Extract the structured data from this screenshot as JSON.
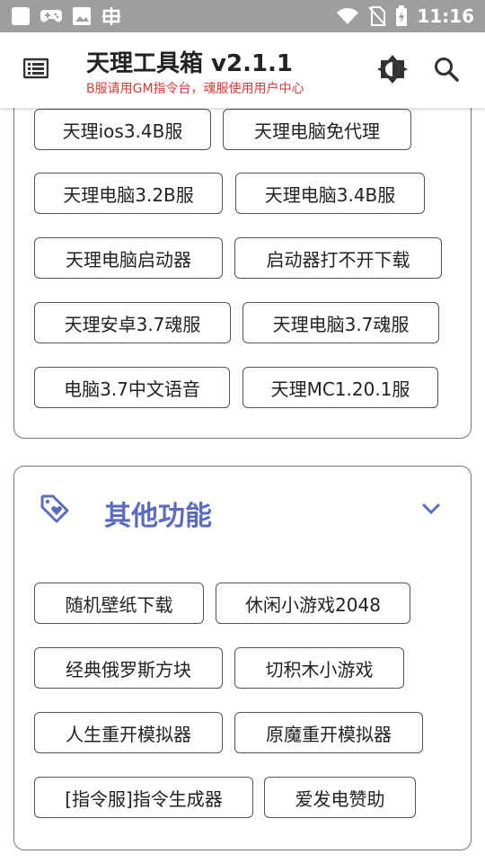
{
  "status_bar": {
    "time": "11:16",
    "icons": [
      "app-square-icon",
      "gamepad-icon",
      "image-icon",
      "bug-icon",
      "wifi-icon",
      "no-sim-icon",
      "battery-charging-icon"
    ]
  },
  "appbar": {
    "title": "天理工具箱 v2.1.1",
    "subtitle": "B服请用GM指令台，魂服使用用户中心",
    "icons": [
      "menu-icon",
      "brightness-icon",
      "search-icon"
    ]
  },
  "section_top": {
    "buttons": [
      "天理ios3.4B服",
      "天理电脑免代理",
      "天理电脑3.2B服",
      "天理电脑3.4B服",
      "天理电脑启动器",
      "启动器打不开下载",
      "天理安卓3.7魂服",
      "天理电脑3.7魂服",
      "电脑3.7中文语音",
      "天理MC1.20.1服"
    ]
  },
  "section_other": {
    "title": "其他功能",
    "icon": "tag-heart-icon",
    "toggle_icon": "chevron-down-icon",
    "buttons": [
      "随机壁纸下载",
      "休闲小游戏2048",
      "经典俄罗斯方块",
      "切积木小游戏",
      "人生重开模拟器",
      "原魔重开模拟器",
      "[指令服]指令生成器",
      "爱发电赞助"
    ]
  },
  "colors": {
    "status_bar": "#9e9e9e",
    "accent": "#5c6bc0",
    "subtitle": "#e53935"
  }
}
